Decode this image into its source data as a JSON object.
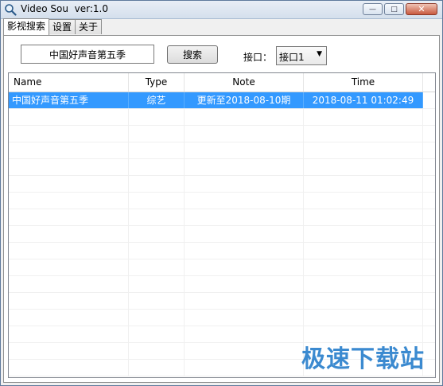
{
  "window": {
    "title": "Video Sou  ver:1.0",
    "minimize": "—",
    "maximize": "□",
    "close": "✕"
  },
  "tabs": [
    {
      "label": "影视搜索",
      "active": true
    },
    {
      "label": "设置",
      "active": false
    },
    {
      "label": "关于",
      "active": false
    }
  ],
  "search": {
    "value": "中国好声音第五季",
    "button_label": "搜索",
    "api_label": "接口：",
    "api_selected": "接口1"
  },
  "list": {
    "headers": {
      "name": "Name",
      "type": "Type",
      "note": "Note",
      "time": "Time"
    },
    "rows": [
      {
        "name": "中国好声音第五季",
        "type": "综艺",
        "note": "更新至2018-08-10期",
        "time": "2018-08-11 01:02:49",
        "selected": true
      }
    ]
  },
  "watermark": "极速下载站",
  "colors": {
    "selection": "#3399ff",
    "titlebar": "#dae4f0",
    "watermark": "#1a76c8"
  }
}
